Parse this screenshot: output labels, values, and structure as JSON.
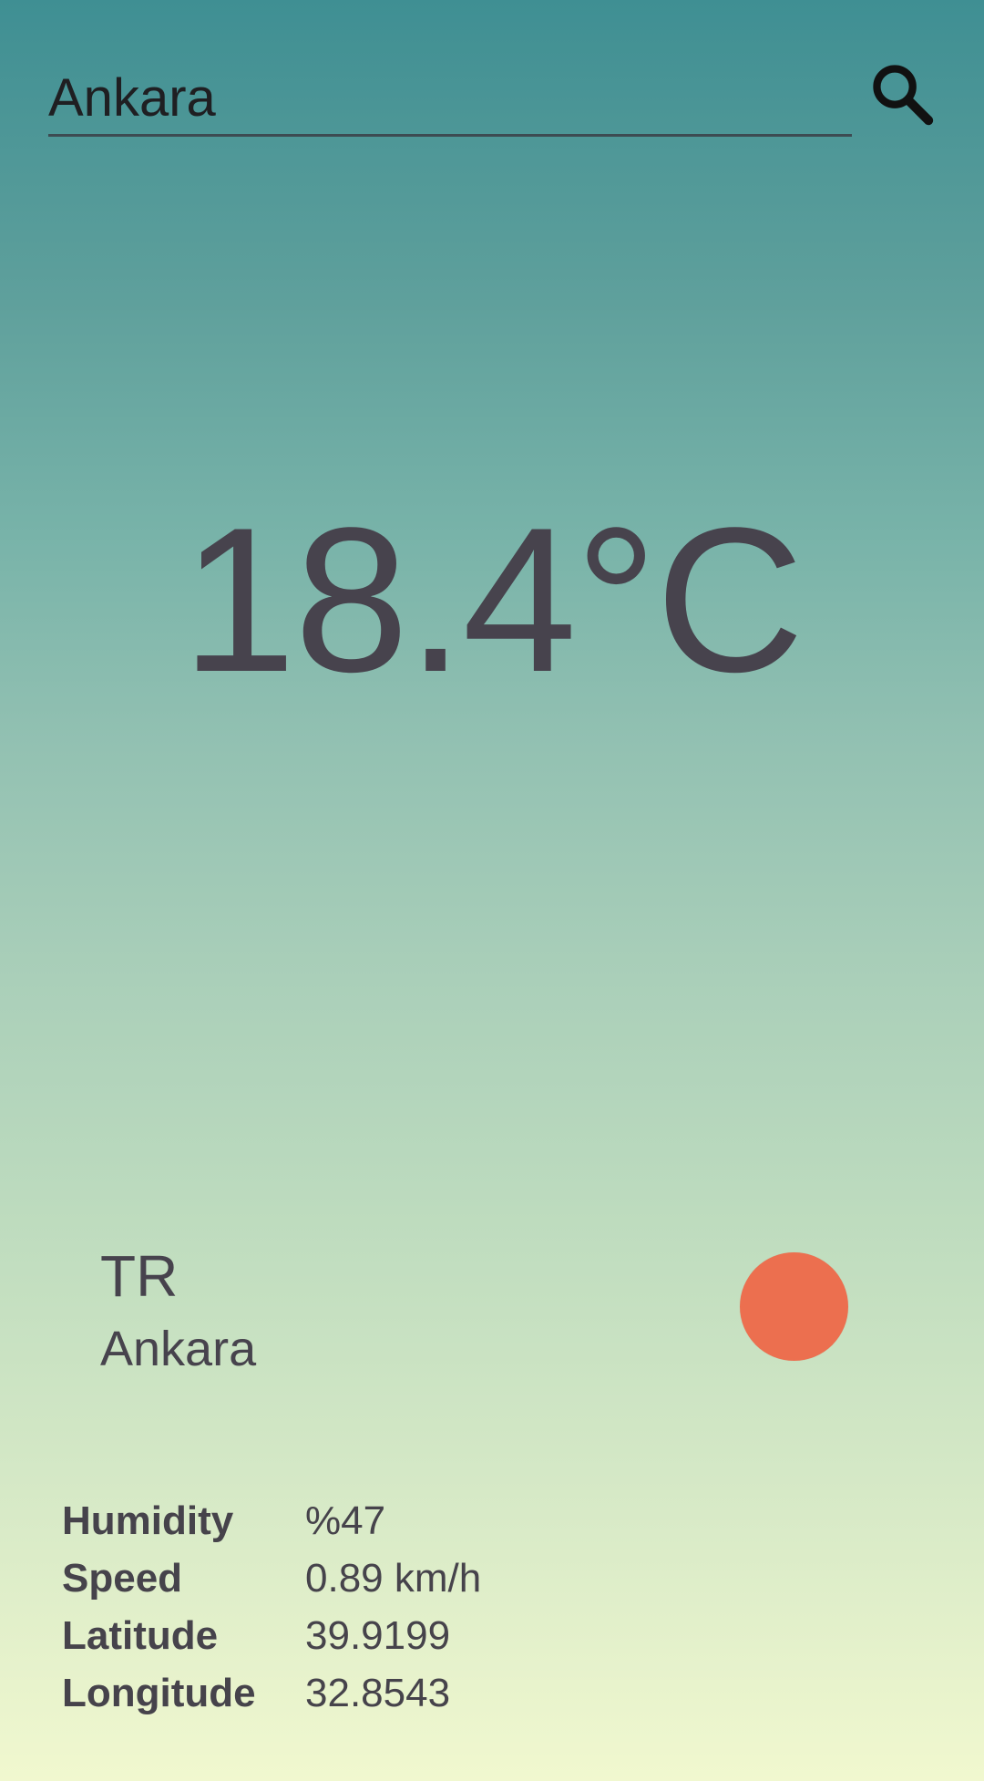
{
  "search": {
    "value": "Ankara",
    "placeholder": ""
  },
  "weather": {
    "temperature": "18.4°C",
    "country": "TR",
    "city": "Ankara",
    "status_color": "#ec6f4f"
  },
  "details": [
    {
      "label": "Humidity",
      "value": "%47"
    },
    {
      "label": "Speed",
      "value": "0.89 km/h"
    },
    {
      "label": "Latitude",
      "value": "39.9199"
    },
    {
      "label": "Longitude",
      "value": "32.8543"
    }
  ],
  "icons": {
    "search": "search-icon"
  }
}
